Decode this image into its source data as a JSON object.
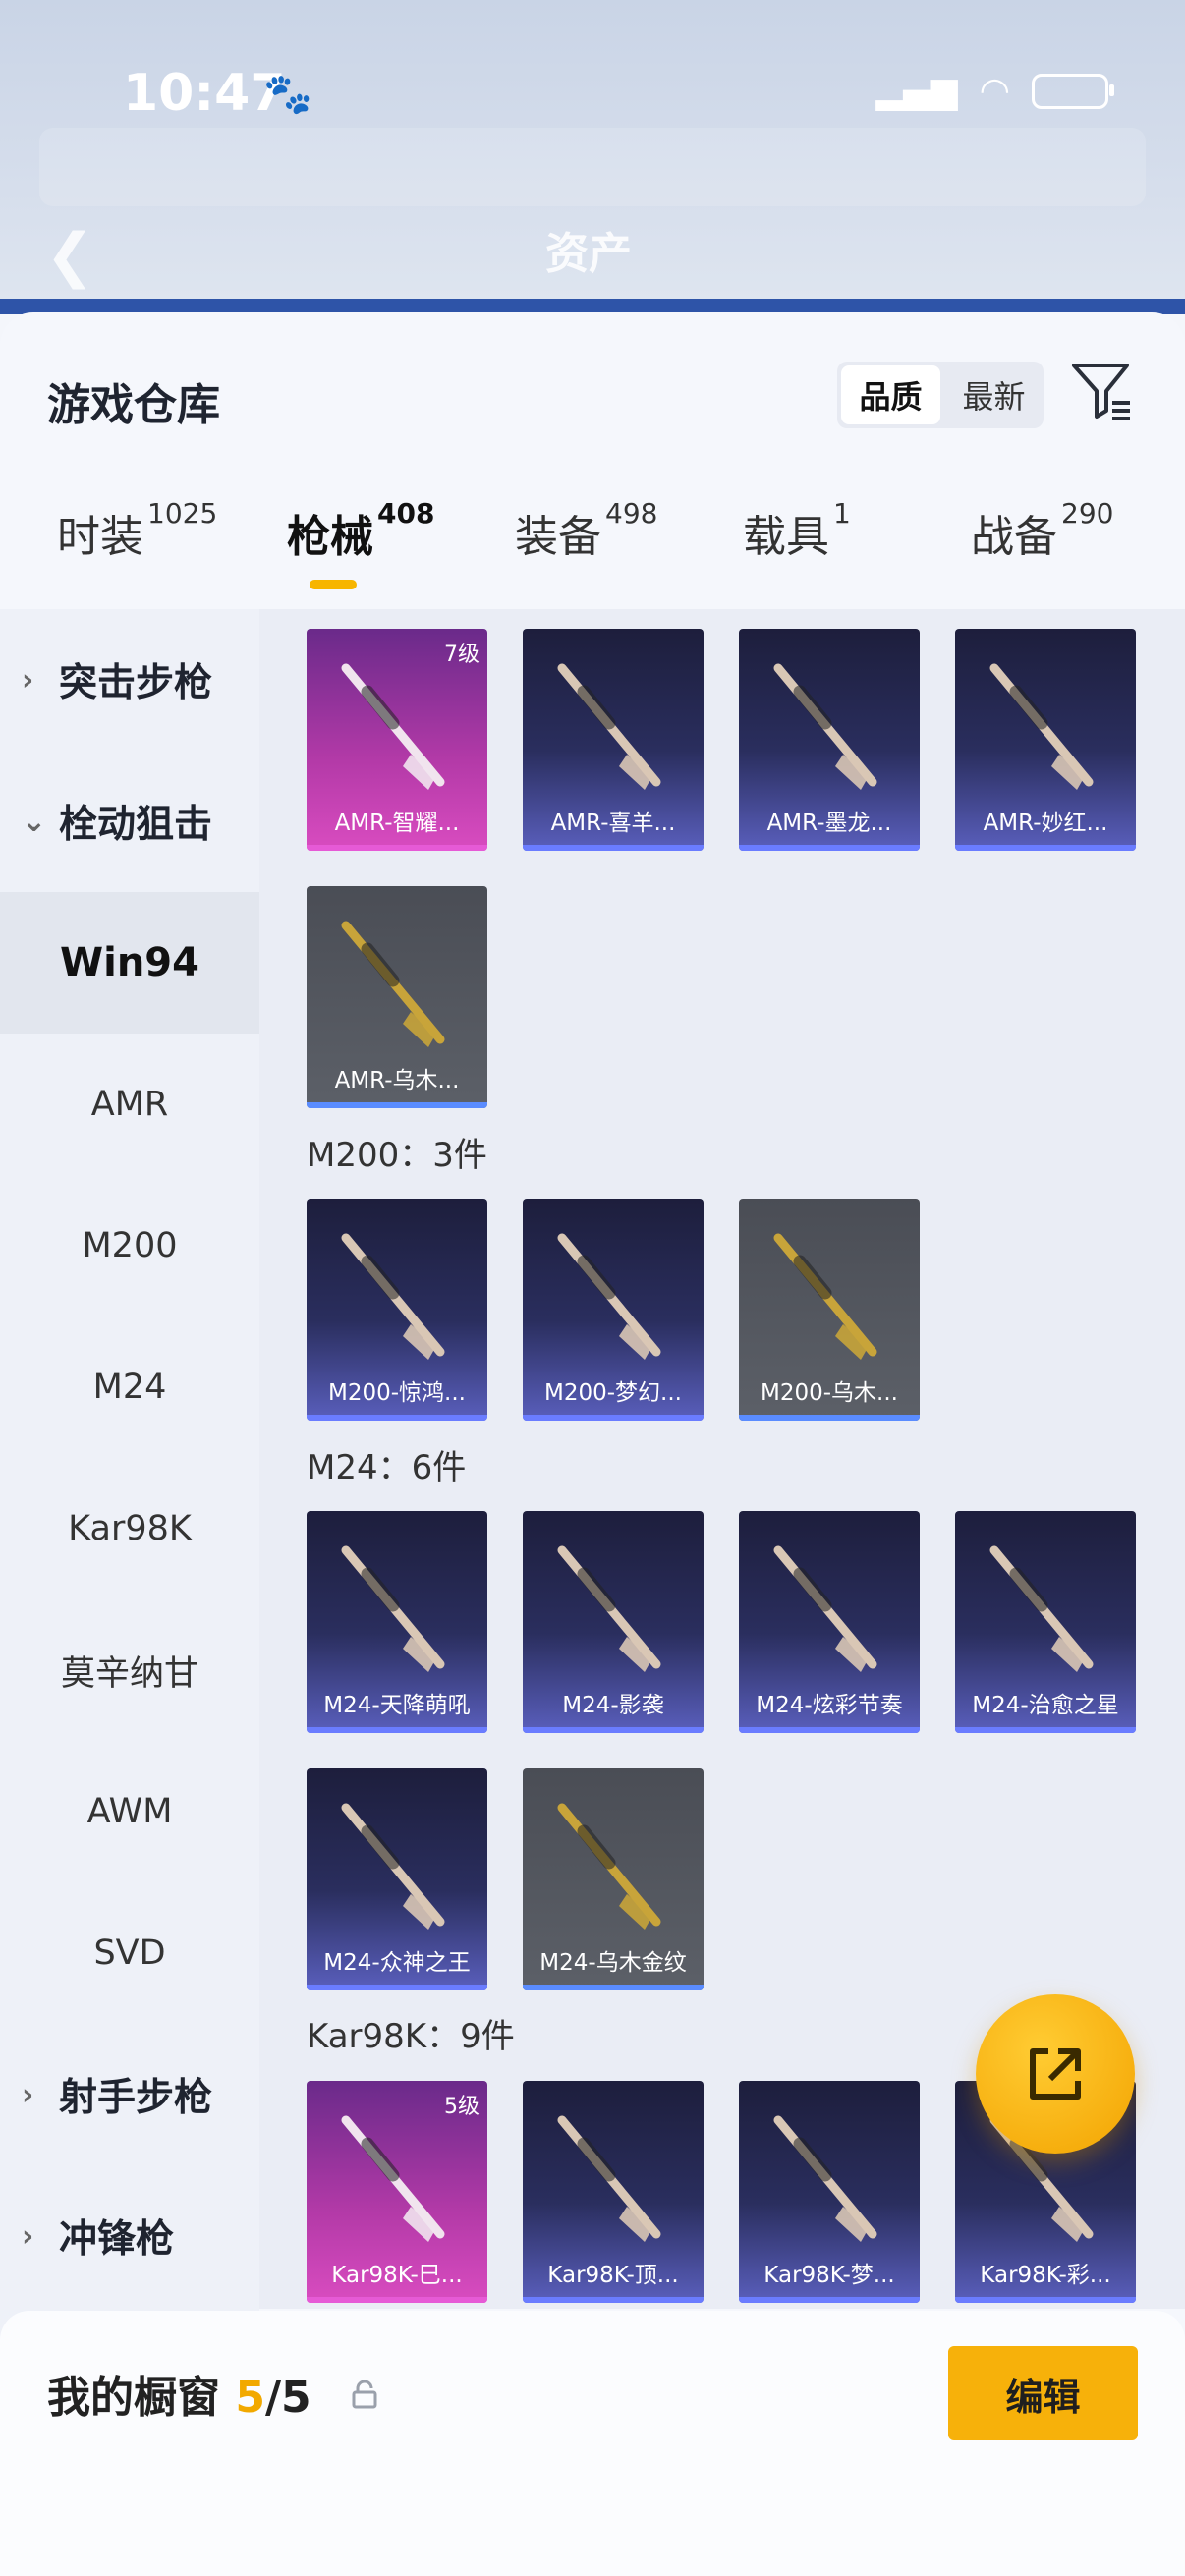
{
  "status": {
    "time": "10:47"
  },
  "header": {
    "title": "资产"
  },
  "sheet": {
    "title": "游戏仓库",
    "sort": {
      "options": [
        "品质",
        "最新"
      ],
      "selected": "品质"
    }
  },
  "tabs": [
    {
      "label": "时装",
      "count": "1025"
    },
    {
      "label": "枪械",
      "count": "408",
      "active": true
    },
    {
      "label": "装备",
      "count": "498"
    },
    {
      "label": "载具",
      "count": "1"
    },
    {
      "label": "战备",
      "count": "290"
    }
  ],
  "sidebar": {
    "items": [
      {
        "label": "突击步枪",
        "type": "category",
        "expanded": false
      },
      {
        "label": "栓动狙击",
        "type": "category",
        "expanded": true
      },
      {
        "label": "Win94",
        "type": "sub",
        "active": true
      },
      {
        "label": "AMR",
        "type": "sub"
      },
      {
        "label": "M200",
        "type": "sub"
      },
      {
        "label": "M24",
        "type": "sub"
      },
      {
        "label": "Kar98K",
        "type": "sub"
      },
      {
        "label": "莫辛纳甘",
        "type": "sub"
      },
      {
        "label": "AWM",
        "type": "sub"
      },
      {
        "label": "SVD",
        "type": "sub"
      },
      {
        "label": "射手步枪",
        "type": "category",
        "expanded": false
      },
      {
        "label": "冲锋枪",
        "type": "category",
        "expanded": false
      }
    ]
  },
  "groups": {
    "m200": "M200：3件",
    "m24": "M24：6件",
    "kar98k": "Kar98K：9件"
  },
  "cards": {
    "amr": [
      {
        "name": "AMR-智耀...",
        "quality": "pink",
        "level": "7级"
      },
      {
        "name": "AMR-喜羊...",
        "quality": "purple"
      },
      {
        "name": "AMR-墨龙...",
        "quality": "purple"
      },
      {
        "name": "AMR-妙红...",
        "quality": "purple"
      },
      {
        "name": "AMR-乌木...",
        "quality": "gray"
      }
    ],
    "m200": [
      {
        "name": "M200-惊鸿...",
        "quality": "purple"
      },
      {
        "name": "M200-梦幻...",
        "quality": "purple"
      },
      {
        "name": "M200-乌木...",
        "quality": "gray"
      }
    ],
    "m24": [
      {
        "name": "M24-天降萌吼",
        "quality": "purple"
      },
      {
        "name": "M24-影袭",
        "quality": "purple"
      },
      {
        "name": "M24-炫彩节奏",
        "quality": "purple"
      },
      {
        "name": "M24-治愈之星",
        "quality": "purple"
      },
      {
        "name": "M24-众神之王",
        "quality": "purple"
      },
      {
        "name": "M24-乌木金纹",
        "quality": "gray"
      }
    ],
    "kar98k": [
      {
        "name": "Kar98K-巳...",
        "quality": "pink",
        "level": "5级"
      },
      {
        "name": "Kar98K-顶...",
        "quality": "purple"
      },
      {
        "name": "Kar98K-梦...",
        "quality": "purple"
      },
      {
        "name": "Kar98K-彩...",
        "quality": "purple"
      }
    ]
  },
  "showcase": {
    "label": "我的橱窗",
    "current": "5",
    "total": "/5",
    "edit_label": "编辑"
  },
  "colors": {
    "accent": "#f7b10a",
    "tab_underline": "#f7b500",
    "header_band": "#2e54a8"
  }
}
